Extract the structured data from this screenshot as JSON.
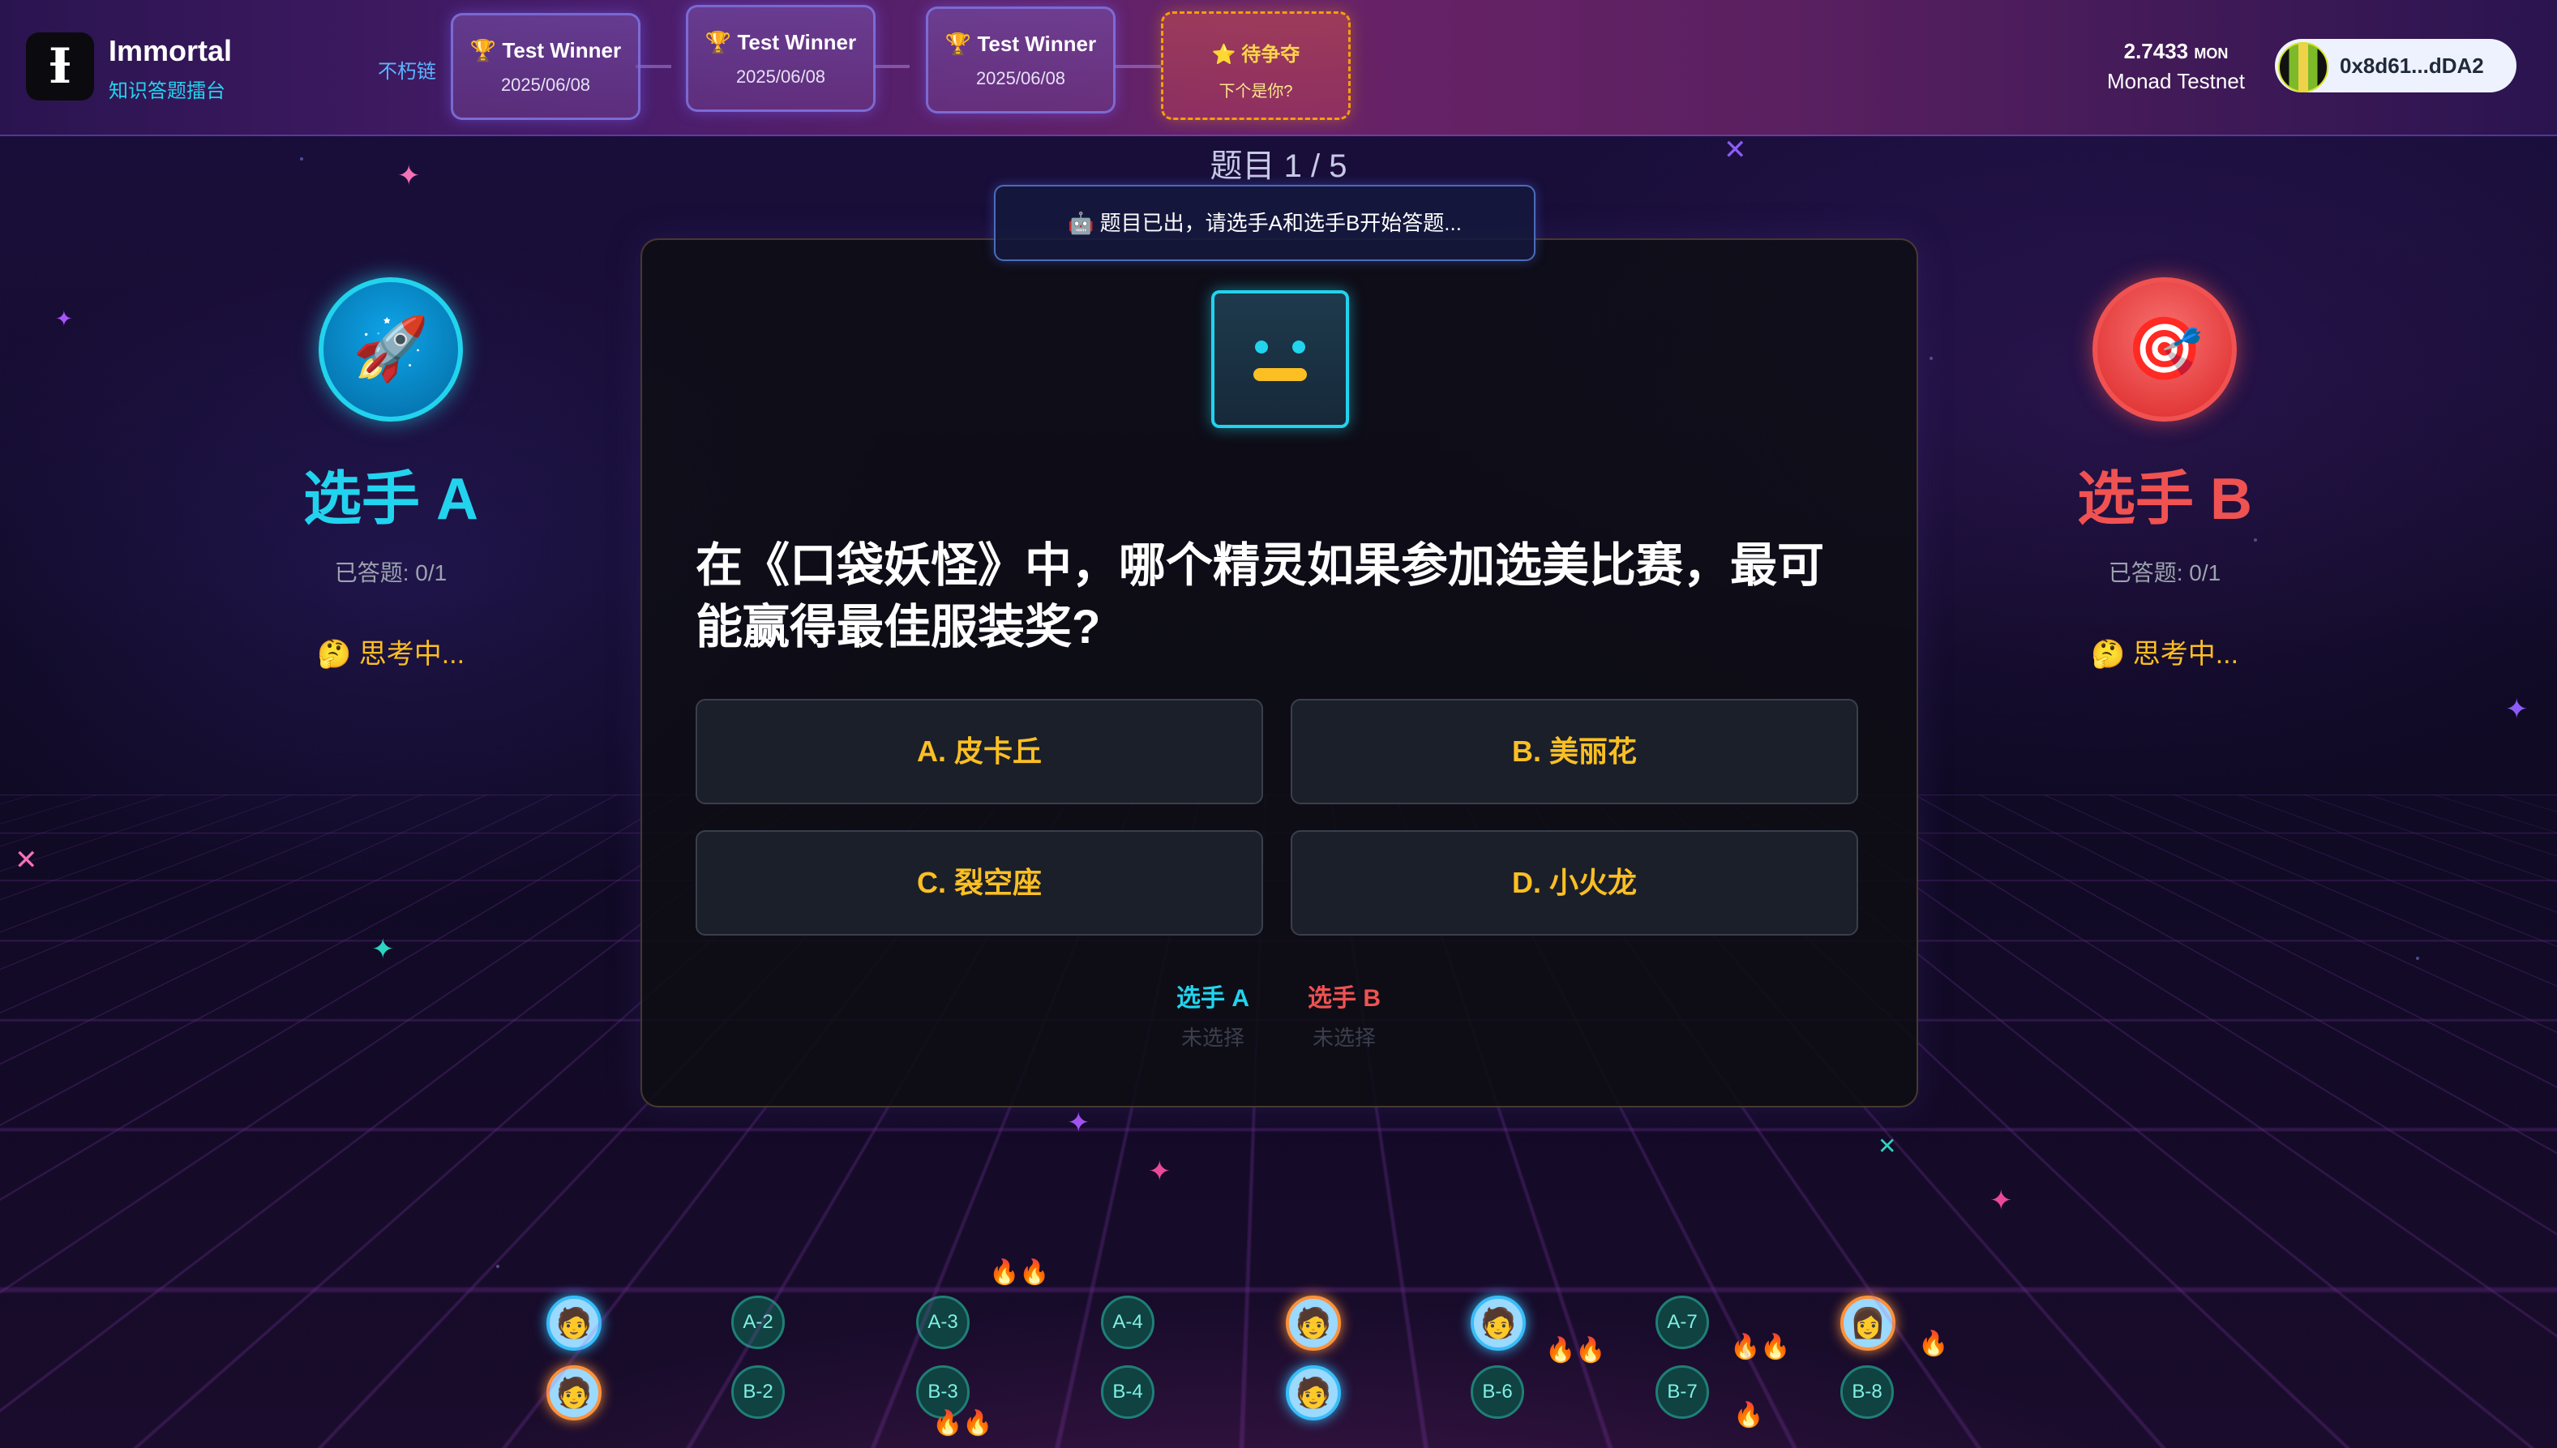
{
  "header": {
    "brand_title": "Immortal",
    "brand_subtitle": "知识答题擂台",
    "logo_glyph": "Ɨ",
    "chain_label": "不朽链",
    "winners": [
      {
        "title": "🏆 Test Winner",
        "date": "2025/06/08"
      },
      {
        "title": "🏆 Test Winner",
        "date": "2025/06/08"
      },
      {
        "title": "🏆 Test Winner",
        "date": "2025/06/08"
      }
    ],
    "pending": {
      "title": "⭐ 待争夺",
      "subtitle": "下个是你?"
    },
    "balance": {
      "amount": "2.7433",
      "unit": "MON",
      "network": "Monad Testnet"
    },
    "wallet_address": "0x8d61...dDA2"
  },
  "game": {
    "counter": "题目 1 / 5",
    "notice": "🤖 题目已出，请选手A和选手B开始答题...",
    "question": "在《口袋妖怪》中，哪个精灵如果参加选美比赛，最可能赢得最佳服装奖?",
    "options": [
      "A. 皮卡丘",
      "B. 美丽花",
      "C. 裂空座",
      "D. 小火龙"
    ],
    "status": [
      {
        "name": "选手 A",
        "state": "未选择"
      },
      {
        "name": "选手 B",
        "state": "未选择"
      }
    ]
  },
  "players": {
    "a": {
      "icon": "🚀",
      "name": "选手 A",
      "answered": "已答题: 0/1",
      "status": "🤔 思考中..."
    },
    "b": {
      "icon": "🎯",
      "name": "选手 B",
      "answered": "已答题: 0/1",
      "status": "🤔 思考中..."
    }
  },
  "tokens": {
    "row1": [
      "🧑",
      "A-2",
      "A-3",
      "A-4",
      "🧑",
      "🧑",
      "A-7",
      "👩"
    ],
    "row2": [
      "🧑",
      "B-2",
      "B-3",
      "B-4",
      "🧑",
      "B-6",
      "B-7",
      "B-8"
    ]
  },
  "colors": {
    "accent_cyan": "#22d3ee",
    "accent_red": "#f05252",
    "option_text": "#fbbf24",
    "pending_border": "#f59e0b"
  }
}
